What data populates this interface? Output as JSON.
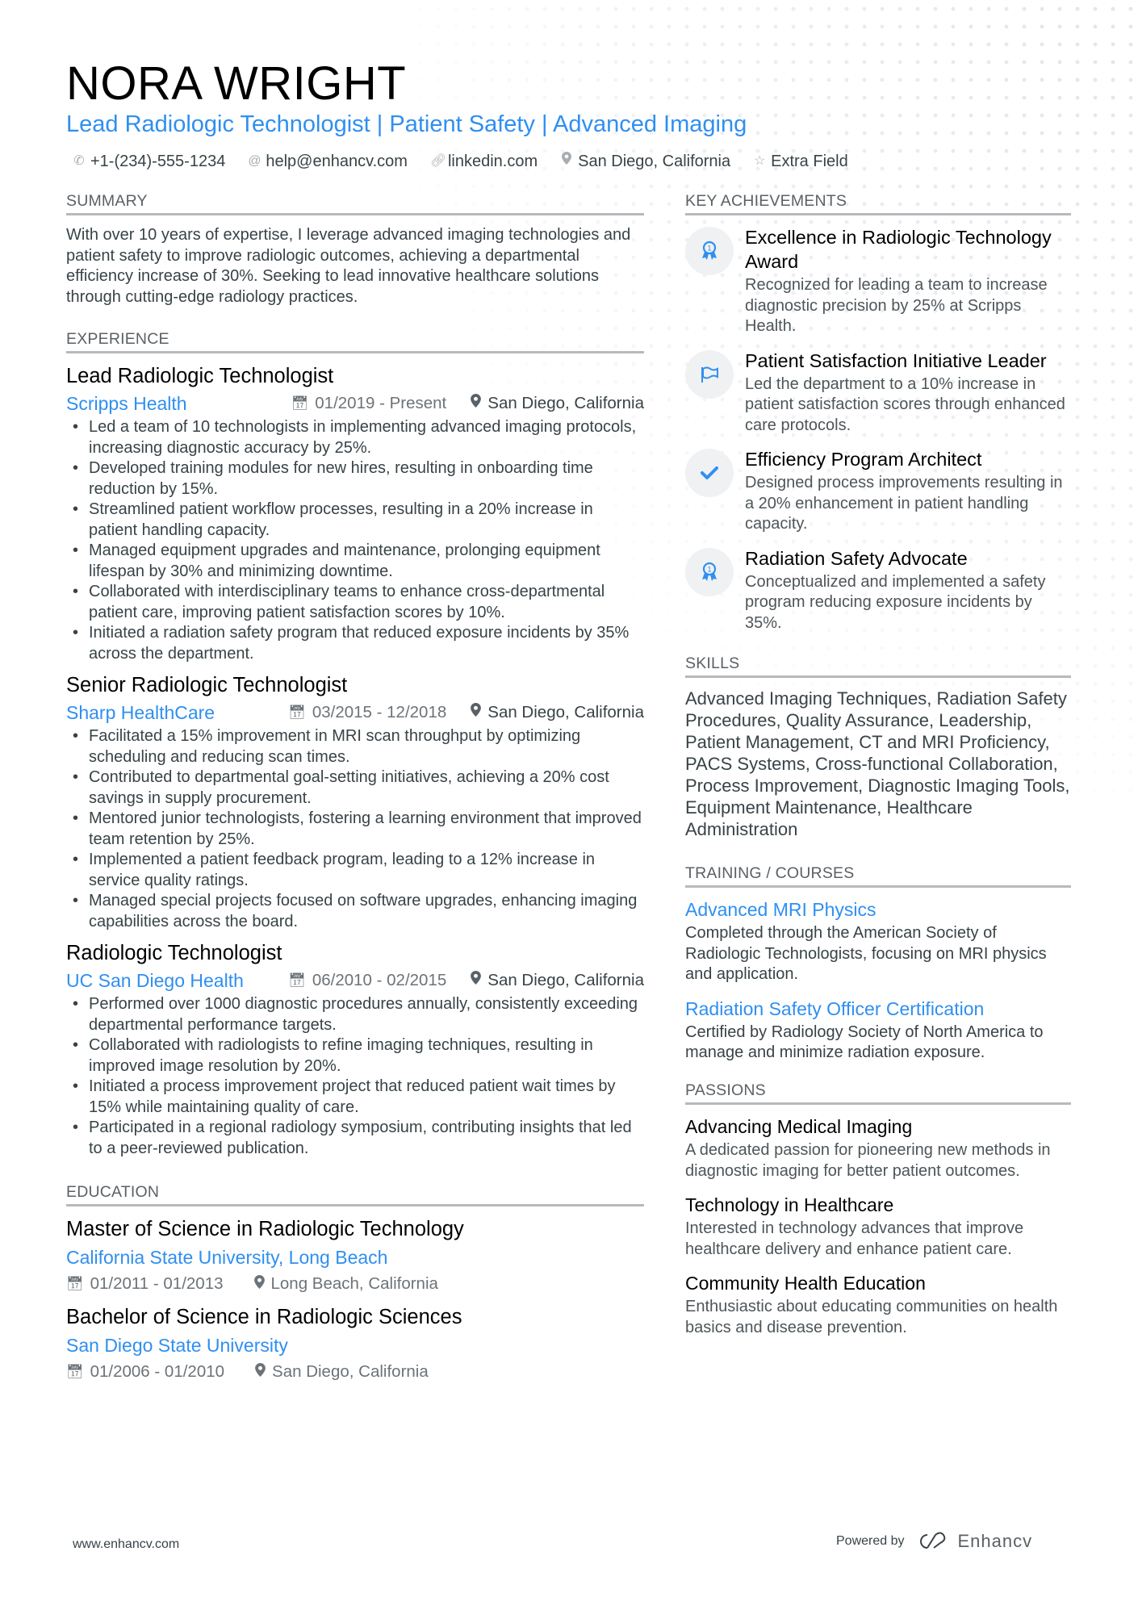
{
  "header": {
    "name": "NORA WRIGHT",
    "headline": "Lead Radiologic Technologist | Patient Safety | Advanced Imaging",
    "contacts": [
      {
        "icon": "phone-icon",
        "text": "+1-(234)-555-1234"
      },
      {
        "icon": "at-icon",
        "text": "help@enhancv.com"
      },
      {
        "icon": "link-icon",
        "text": "linkedin.com"
      },
      {
        "icon": "location-pin-icon",
        "text": "San Diego, California"
      },
      {
        "icon": "star-icon",
        "text": "Extra Field"
      }
    ]
  },
  "summary": {
    "title": "SUMMARY",
    "text": "With over 10 years of expertise, I leverage advanced imaging technologies and patient safety to improve radiologic outcomes, achieving a departmental efficiency increase of 30%. Seeking to lead innovative healthcare solutions through cutting-edge radiology practices."
  },
  "experience": {
    "title": "EXPERIENCE",
    "jobs": [
      {
        "title": "Lead Radiologic Technologist",
        "company": "Scripps Health",
        "dates": "01/2019 - Present",
        "location": "San Diego, California",
        "bullets": [
          "Led a team of 10 technologists in implementing advanced imaging protocols, increasing diagnostic accuracy by 25%.",
          "Developed training modules for new hires, resulting in onboarding time reduction by 15%.",
          "Streamlined patient workflow processes, resulting in a 20% increase in patient handling capacity.",
          "Managed equipment upgrades and maintenance, prolonging equipment lifespan by 30% and minimizing downtime.",
          "Collaborated with interdisciplinary teams to enhance cross-departmental patient care, improving patient satisfaction scores by 10%.",
          "Initiated a radiation safety program that reduced exposure incidents by 35% across the department."
        ]
      },
      {
        "title": "Senior Radiologic Technologist",
        "company": "Sharp HealthCare",
        "dates": "03/2015 - 12/2018",
        "location": "San Diego, California",
        "bullets": [
          "Facilitated a 15% improvement in MRI scan throughput by optimizing scheduling and reducing scan times.",
          "Contributed to departmental goal-setting initiatives, achieving a 20% cost savings in supply procurement.",
          "Mentored junior technologists, fostering a learning environment that improved team retention by 25%.",
          "Implemented a patient feedback program, leading to a 12% increase in service quality ratings.",
          "Managed special projects focused on software upgrades, enhancing imaging capabilities across the board."
        ]
      },
      {
        "title": "Radiologic Technologist",
        "company": "UC San Diego Health",
        "dates": "06/2010 - 02/2015",
        "location": "San Diego, California",
        "bullets": [
          "Performed over 1000 diagnostic procedures annually, consistently exceeding departmental performance targets.",
          "Collaborated with radiologists to refine imaging techniques, resulting in improved image resolution by 20%.",
          "Initiated a process improvement project that reduced patient wait times by 15% while maintaining quality of care.",
          "Participated in a regional radiology symposium, contributing insights that led to a peer-reviewed publication."
        ]
      }
    ]
  },
  "education": {
    "title": "EDUCATION",
    "items": [
      {
        "degree": "Master of Science in Radiologic Technology",
        "school": "California State University, Long Beach",
        "dates": "01/2011 - 01/2013",
        "location": "Long Beach, California"
      },
      {
        "degree": "Bachelor of Science in Radiologic Sciences",
        "school": "San Diego State University",
        "dates": "01/2006 - 01/2010",
        "location": "San Diego, California"
      }
    ]
  },
  "achievements": {
    "title": "KEY ACHIEVEMENTS",
    "items": [
      {
        "icon": "award-ribbon-icon",
        "title": "Excellence in Radiologic Technology Award",
        "desc": "Recognized for leading a team to increase diagnostic precision by 25% at Scripps Health."
      },
      {
        "icon": "flag-icon",
        "title": "Patient Satisfaction Initiative Leader",
        "desc": "Led the department to a 10% increase in patient satisfaction scores through enhanced care protocols."
      },
      {
        "icon": "checkmark-icon",
        "title": "Efficiency Program Architect",
        "desc": "Designed process improvements resulting in a 20% enhancement in patient handling capacity."
      },
      {
        "icon": "award-ribbon-icon",
        "title": "Radiation Safety Advocate",
        "desc": "Conceptualized and implemented a safety program reducing exposure incidents by 35%."
      }
    ]
  },
  "skills": {
    "title": "SKILLS",
    "text": "Advanced Imaging Techniques, Radiation Safety Procedures, Quality Assurance, Leadership, Patient Management, CT and MRI Proficiency, PACS Systems, Cross-functional Collaboration, Process Improvement, Diagnostic Imaging Tools, Equipment Maintenance, Healthcare Administration"
  },
  "training": {
    "title": "TRAINING / COURSES",
    "items": [
      {
        "title": "Advanced MRI Physics",
        "desc": "Completed through the American Society of Radiologic Technologists, focusing on MRI physics and application."
      },
      {
        "title": "Radiation Safety Officer Certification",
        "desc": "Certified by Radiology Society of North America to manage and minimize radiation exposure."
      }
    ]
  },
  "passions": {
    "title": "PASSIONS",
    "items": [
      {
        "title": "Advancing Medical Imaging",
        "desc": "A dedicated passion for pioneering new methods in diagnostic imaging for better patient outcomes."
      },
      {
        "title": "Technology in Healthcare",
        "desc": "Interested in technology advances that improve healthcare delivery and enhance patient care."
      },
      {
        "title": "Community Health Education",
        "desc": "Enthusiastic about educating communities on health basics and disease prevention."
      }
    ]
  },
  "footer": {
    "website": "www.enhancv.com",
    "powered_by": "Powered by",
    "brand": "Enhancv"
  },
  "colors": {
    "accent": "#2f8ff0",
    "text": "#384347",
    "heading": "#000000",
    "muted": "#6c7378",
    "rule": "#b6babd",
    "icon_bg": "#eff1f3"
  }
}
